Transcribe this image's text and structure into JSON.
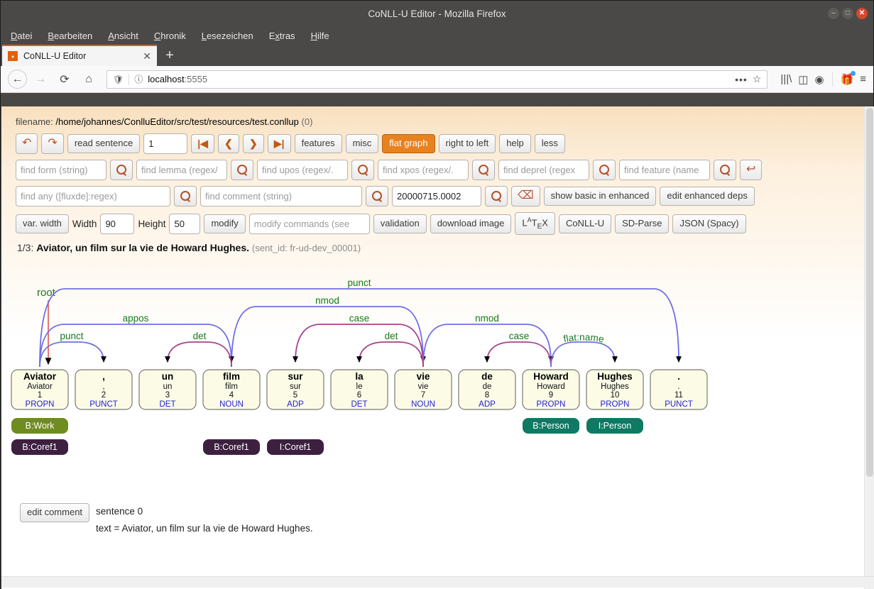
{
  "window": {
    "title": "CoNLL-U Editor - Mozilla Firefox",
    "minimize": "–",
    "maximize": "□",
    "close": "✕"
  },
  "menubar": [
    {
      "label": "Datei",
      "accel": "D"
    },
    {
      "label": "Bearbeiten",
      "accel": "B"
    },
    {
      "label": "Ansicht",
      "accel": "A"
    },
    {
      "label": "Chronik",
      "accel": "C"
    },
    {
      "label": "Lesezeichen",
      "accel": "L"
    },
    {
      "label": "Extras",
      "accel": "x"
    },
    {
      "label": "Hilfe",
      "accel": "H"
    }
  ],
  "tabs": [
    {
      "label": "CoNLL-U Editor",
      "close": "✕"
    }
  ],
  "newtab_label": "+",
  "navbar": {
    "back": "←",
    "forward": "→",
    "reload": "⟳",
    "home": "⌂",
    "url_host": "localhost",
    "url_port": ":5555",
    "page_actions": "•••",
    "bookmark_star": "☆",
    "library": "library-icon",
    "sidebars": "sidebar-icon",
    "account": "account-icon",
    "extension": "extension-icon",
    "menu": "≡"
  },
  "app": {
    "filename_label": "filename:",
    "filename_path": "/home/johannes/ConlluEditor/src/test/resources/test.conllup",
    "filename_count": "(0)",
    "toolbar_row1": {
      "undo": "↶",
      "redo": "↷",
      "read_sentence": "read sentence",
      "sentence_number": "1",
      "first": "|◀",
      "prev": "❮",
      "next": "❯",
      "last": "▶|",
      "features": "features",
      "misc": "misc",
      "flat_graph": "flat graph",
      "right_to_left": "right to left",
      "help": "help",
      "less": "less"
    },
    "search_row": {
      "form_placeholder": "find form (string)",
      "form_value": "",
      "lemma_placeholder": "find lemma (regex/",
      "lemma_value": "",
      "upos_placeholder": "find upos (regex/.",
      "upos_value": "",
      "xpos_placeholder": "find xpos (regex/.",
      "xpos_value": "",
      "deprel_placeholder": "find deprel (regex",
      "deprel_value": "",
      "feature_placeholder": "find feature (name",
      "feature_value": "",
      "search_icon": "search-icon",
      "join_icon": "↩"
    },
    "search_row2": {
      "any_placeholder": "find any ([fluxde]:regex)",
      "any_value": "",
      "comment_placeholder": "find comment (string)",
      "comment_value": "",
      "sentid_value": "20000715.0002",
      "search_icon": "search-icon",
      "clear_icon": "⌫",
      "show_basic_in_enhanced": "show basic in enhanced",
      "edit_enhanced_deps": "edit enhanced deps"
    },
    "settings_row": {
      "var_width": "var. width",
      "width_label": "Width",
      "width_value": "90",
      "height_label": "Height",
      "height_value": "50",
      "modify": "modify",
      "modify_placeholder": "modify commands (see",
      "modify_value": "",
      "validation": "validation",
      "download_image": "download image",
      "latex": "LATEX",
      "conllu": "CoNLL-U",
      "sd_parse": "SD-Parse",
      "json_spacy": "JSON (Spacy)"
    },
    "sentence_header": {
      "index": "1/3:",
      "text": "Aviator, un film sur la vie de Howard Hughes.",
      "sent_id": "(sent_id: fr-ud-dev_00001)"
    },
    "comment_section": {
      "edit_comment": "edit comment",
      "lines": [
        "sentence 0",
        "text = Aviator, un film sur la vie de Howard Hughes."
      ]
    }
  },
  "colors": {
    "orange_accent": "#e8821e",
    "root_arrow": "#e8776f",
    "deprel_label": "#167a18",
    "arc_blue": "#6f6fe8",
    "arc_magenta": "#a8418c",
    "box_fill": "#fbfbe6",
    "box_stroke": "#7a7a6e",
    "upos": "#1f1fd6",
    "badge_work": "#6f8c1e",
    "badge_coref": "#3d2040",
    "badge_person": "#0d7a63"
  },
  "graph": {
    "root_label": "root",
    "tokens": [
      {
        "form": "Aviator",
        "lemma": "Aviator",
        "id": "1",
        "upos": "PROPN"
      },
      {
        "form": ",",
        "lemma": ",",
        "id": "2",
        "upos": "PUNCT"
      },
      {
        "form": "un",
        "lemma": "un",
        "id": "3",
        "upos": "DET"
      },
      {
        "form": "film",
        "lemma": "film",
        "id": "4",
        "upos": "NOUN"
      },
      {
        "form": "sur",
        "lemma": "sur",
        "id": "5",
        "upos": "ADP"
      },
      {
        "form": "la",
        "lemma": "le",
        "id": "6",
        "upos": "DET"
      },
      {
        "form": "vie",
        "lemma": "vie",
        "id": "7",
        "upos": "NOUN"
      },
      {
        "form": "de",
        "lemma": "de",
        "id": "8",
        "upos": "ADP"
      },
      {
        "form": "Howard",
        "lemma": "Howard",
        "id": "9",
        "upos": "PROPN"
      },
      {
        "form": "Hughes",
        "lemma": "Hughes",
        "id": "10",
        "upos": "PROPN"
      },
      {
        "form": ".",
        "lemma": ".",
        "id": "11",
        "upos": "PUNCT"
      }
    ],
    "arcs": [
      {
        "deprel": "punct",
        "head": 1,
        "dep": 11,
        "color": "blue",
        "level": 4
      },
      {
        "deprel": "nmod",
        "head": 4,
        "dep": 7,
        "color": "blue",
        "level": 3
      },
      {
        "deprel": "appos",
        "head": 1,
        "dep": 4,
        "color": "blue",
        "level": 2
      },
      {
        "deprel": "case",
        "head": 7,
        "dep": 5,
        "color": "magenta",
        "level": 2
      },
      {
        "deprel": "nmod",
        "head": 7,
        "dep": 9,
        "color": "blue",
        "level": 2
      },
      {
        "deprel": "punct",
        "head": 1,
        "dep": 2,
        "color": "blue",
        "level": 1
      },
      {
        "deprel": "det",
        "head": 4,
        "dep": 3,
        "color": "magenta",
        "level": 1
      },
      {
        "deprel": "det",
        "head": 7,
        "dep": 6,
        "color": "magenta",
        "level": 1
      },
      {
        "deprel": "case",
        "head": 9,
        "dep": 8,
        "color": "magenta",
        "level": 1
      },
      {
        "deprel": "flat:name",
        "head": 9,
        "dep": 10,
        "color": "blue",
        "level": 1
      }
    ],
    "annotations_row1": [
      {
        "label": "B:Work",
        "token": 1,
        "kind": "work"
      }
    ],
    "annotations_row1b": [
      {
        "label": "B:Person",
        "token": 9,
        "kind": "person"
      },
      {
        "label": "I:Person",
        "token": 10,
        "kind": "person"
      }
    ],
    "annotations_row2": [
      {
        "label": "B:Coref1",
        "token": 1,
        "kind": "coref"
      },
      {
        "label": "B:Coref1",
        "token": 4,
        "kind": "coref"
      },
      {
        "label": "I:Coref1",
        "token": 5,
        "kind": "coref"
      }
    ]
  }
}
